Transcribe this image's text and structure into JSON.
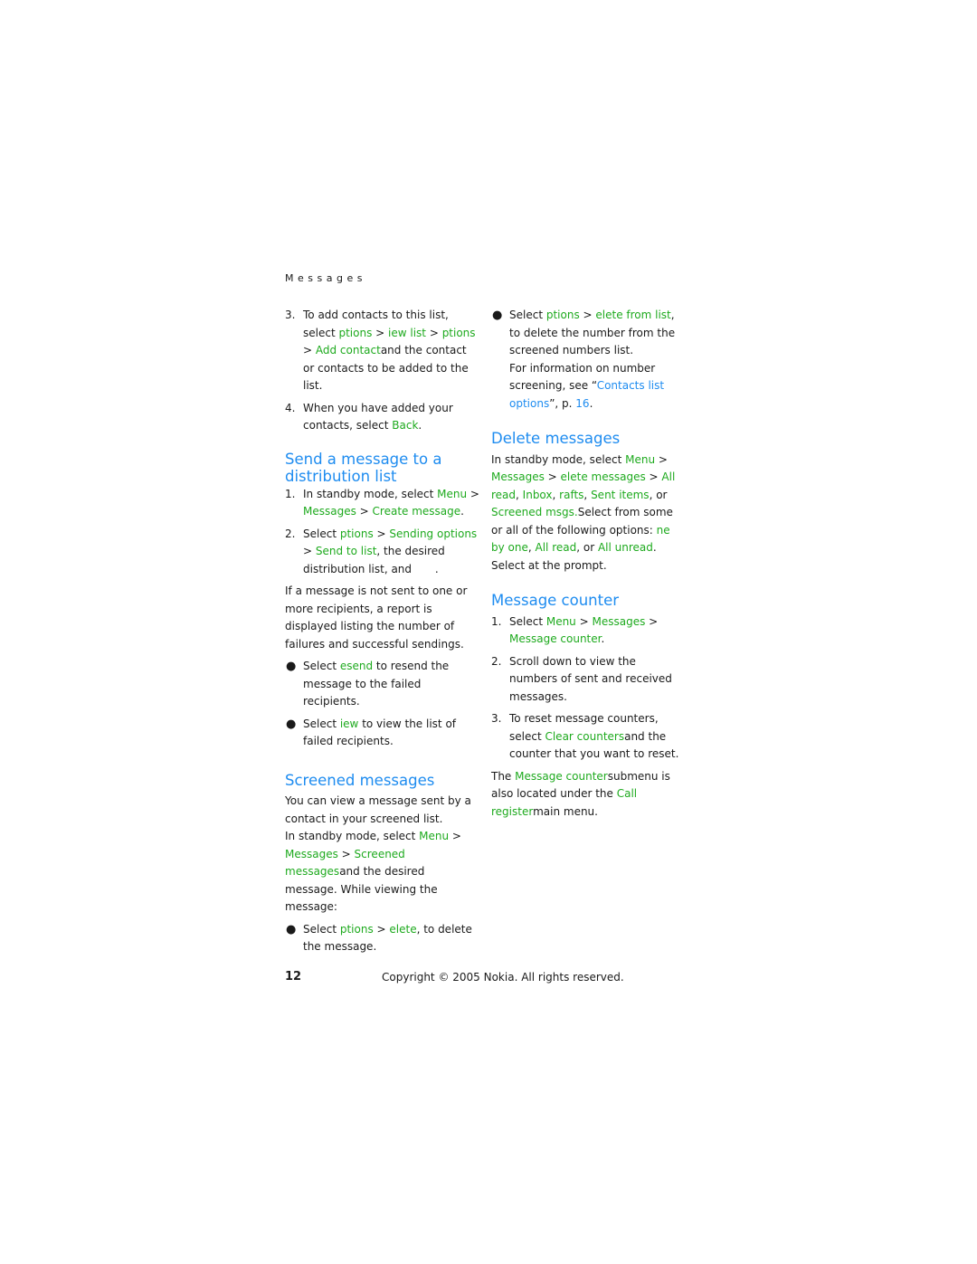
{
  "running_head": "Messages",
  "left_column": {
    "step3": {
      "num": "3.",
      "t1": "To add contacts to this list, select ",
      "g1": "ptions",
      "s1": " > ",
      "g2": "iew list",
      "s2": " > ",
      "g3": "ptions",
      "s3": " > ",
      "g4": "Add contact",
      "t2": "and the contact or contacts to be added to the list."
    },
    "step4": {
      "num": "4.",
      "t1": "When you have added your contacts, select ",
      "g1": "Back",
      "t2": "."
    },
    "section1": {
      "heading": "Send a message to a distribution list",
      "step1": {
        "num": "1.",
        "t1": "In standby mode, select ",
        "g1": "Menu",
        "s1": " > ",
        "g2": "Messages",
        "s2": " > ",
        "g3": "Create message",
        "t2": "."
      },
      "step2": {
        "num": "2.",
        "t1": "Select ",
        "g1": "ptions",
        "s1": " > ",
        "g2": "Sending options",
        "s2": " > ",
        "g3": "Send to list",
        "t2": ", the desired distribution list, and ",
        "t3": "."
      },
      "para": "If a message is not sent to one or more recipients, a report is displayed listing the number of failures and successful sendings.",
      "bullet1": {
        "t1": "Select ",
        "g1": "esend",
        "t2": " to resend the message to the failed recipients."
      },
      "bullet2": {
        "t1": "Select ",
        "g1": "iew",
        "t2": " to view the list of failed recipients."
      }
    },
    "section2": {
      "heading": "Screened messages",
      "para1": "You can view a message sent by a contact in your screened list.",
      "para2": {
        "t1": "In standby mode, select ",
        "g1": "Menu",
        "s1": " > ",
        "g2": "Messages",
        "s2": " > ",
        "g3": "Screened messages",
        "t2": "and the desired message. While viewing the message:"
      },
      "bullet1": {
        "t1": "Select ",
        "g1": "ptions",
        "s1": " > ",
        "g2": "elete",
        "t2": ", to delete the message."
      }
    }
  },
  "right_column": {
    "bullet1": {
      "t1": "Select ",
      "g1": "ptions",
      "s1": " > ",
      "g2": "elete from list",
      "t2": ", to delete the number from the screened numbers list.",
      "t3": "For information on number screening, see “",
      "link": "Contacts list options",
      "t4": "”, p. ",
      "page": "16",
      "t5": "."
    },
    "section3": {
      "heading": "Delete messages",
      "para": {
        "t1": "In standby mode, select ",
        "g1": "Menu",
        "s1": " > ",
        "g2": "Messages",
        "s2": " > ",
        "g3": "elete messages",
        "s3": " > ",
        "g4": "All read",
        "c1": ", ",
        "g5": "Inbox",
        "c2": ", ",
        "g6": "rafts",
        "c3": ", ",
        "g7": "Sent items",
        "c4": ", or ",
        "g8": "Screened msgs.",
        "t2": "Select from some or all of the following options: ",
        "g9": "ne by one",
        "c5": ", ",
        "g10": "All read",
        "c6": ", or ",
        "g11": "All unread",
        "t3": ". Select at the prompt."
      }
    },
    "section4": {
      "heading": "Message counter",
      "step1": {
        "num": "1.",
        "t1": "Select ",
        "g1": "Menu",
        "s1": " > ",
        "g2": "Messages",
        "s2": " > ",
        "g3": "Message counter",
        "t2": "."
      },
      "step2": {
        "num": "2.",
        "t1": "Scroll down to view the numbers of sent and received messages."
      },
      "step3": {
        "num": "3.",
        "t1": "To reset message counters, select ",
        "g1": "Clear counters",
        "t2": "and the counter that you want to reset."
      },
      "para": {
        "t1": "The ",
        "g1": "Message counter",
        "t2": "submenu is also located under the ",
        "g2": "Call register",
        "t3": "main menu."
      }
    }
  },
  "footer": {
    "page_number": "12",
    "copyright": "Copyright © 2005 Nokia. All rights reserved."
  },
  "colors": {
    "heading_blue": "#1e8cf0",
    "menu_green": "#1eaa1e",
    "text": "#1a1a1a"
  }
}
